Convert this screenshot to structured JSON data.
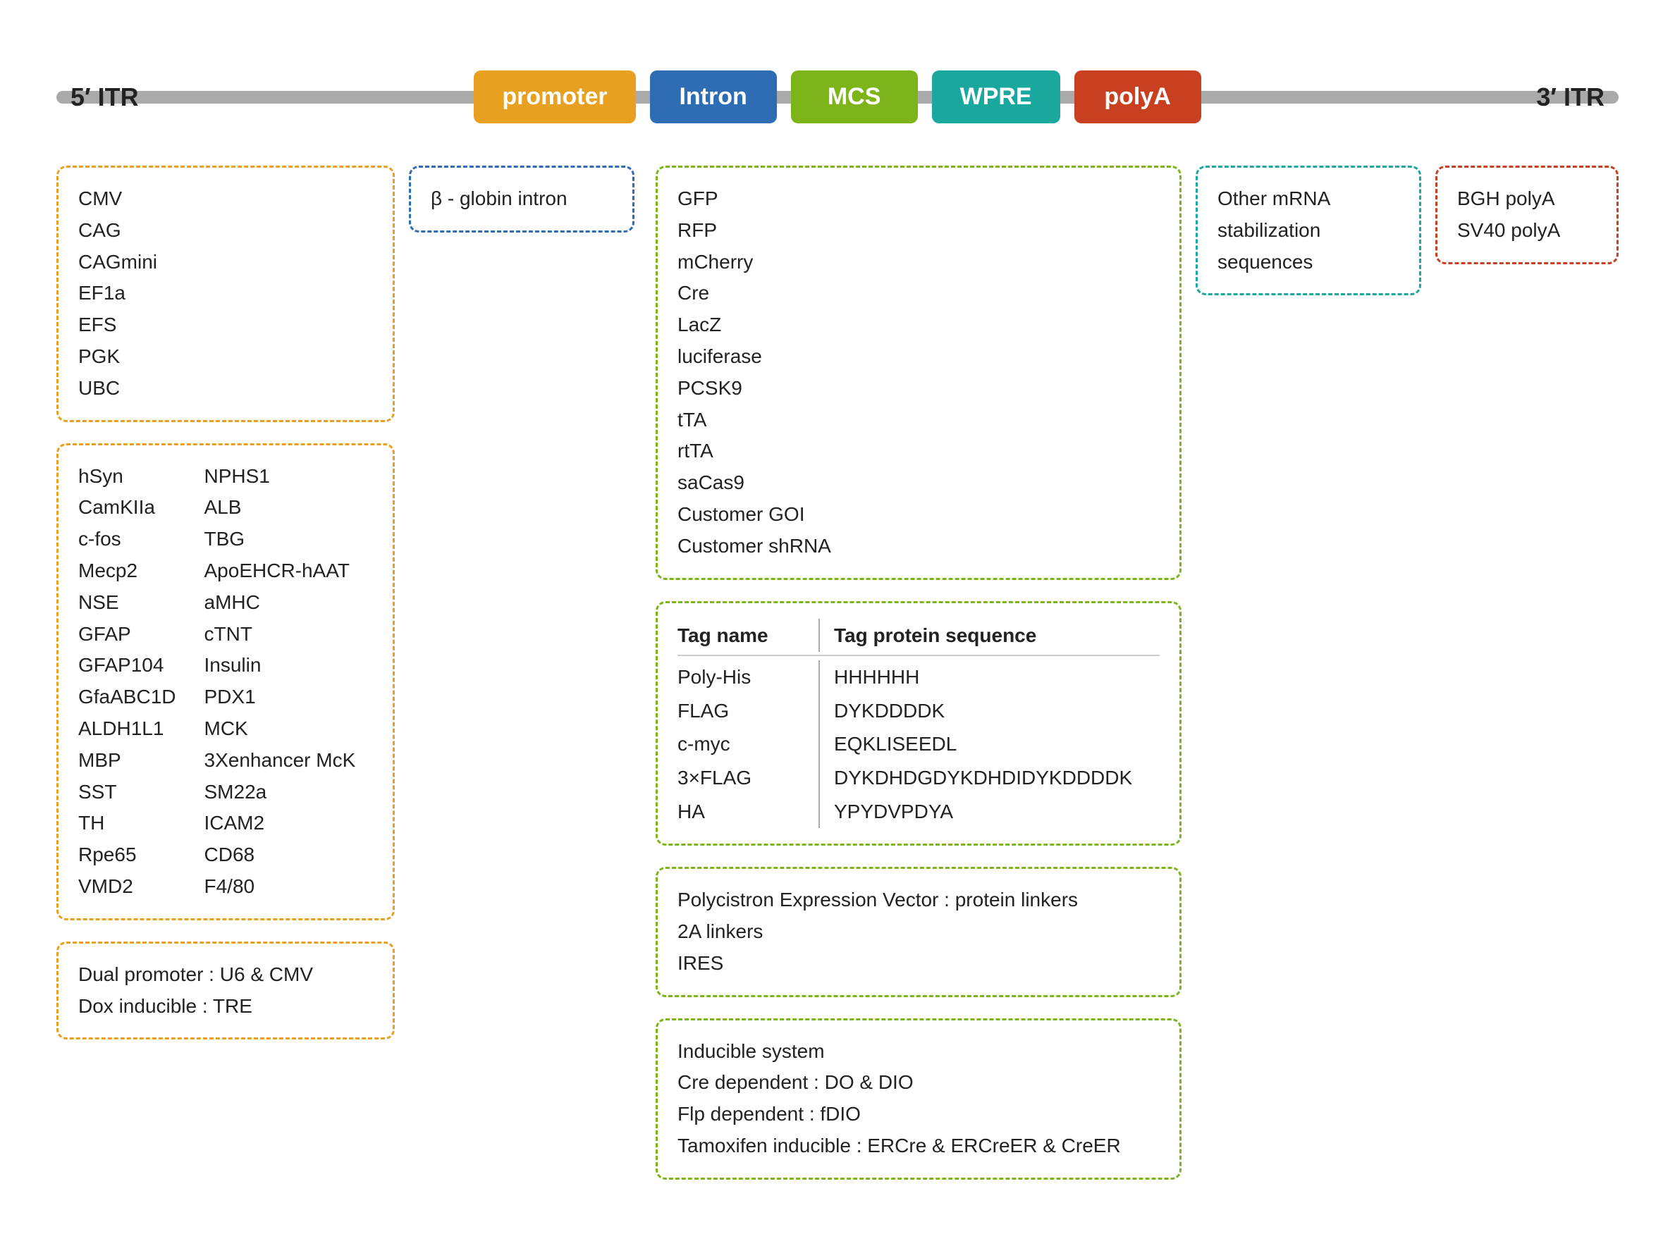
{
  "itr5": "5′ ITR",
  "itr3": "3′ ITR",
  "components": [
    {
      "label": "promoter",
      "class": "box-promoter"
    },
    {
      "label": "Intron",
      "class": "box-intron"
    },
    {
      "label": "MCS",
      "class": "box-mcs"
    },
    {
      "label": "WPRE",
      "class": "box-wpre"
    },
    {
      "label": "polyA",
      "class": "box-polya"
    }
  ],
  "promoter_box1": {
    "items": [
      "CMV",
      "CAG",
      "CAGmini",
      "EF1a",
      "EFS",
      "PGK",
      "UBC"
    ]
  },
  "promoter_box2": {
    "col1": [
      "hSyn",
      "CamKIIa",
      "c-fos",
      "Mecp2",
      "NSE",
      "GFAP",
      "GFAP104",
      "GfaABC1D",
      "ALDH1L1",
      "MBP",
      "SST",
      "TH",
      "Rpe65",
      "VMD2"
    ],
    "col2": [
      "NPHS1",
      "ALB",
      "TBG",
      "ApoEHCR-hAAT",
      "aMHC",
      "cTNT",
      "Insulin",
      "PDX1",
      "MCK",
      "3Xenhancer McK",
      "SM22a",
      "ICAM2",
      "CD68",
      "F4/80"
    ]
  },
  "promoter_box3": {
    "items": [
      "Dual promoter : U6 & CMV",
      "Dox inducible : TRE"
    ]
  },
  "intron_box1": {
    "text": "β - globin intron"
  },
  "mcs_box1": {
    "items": [
      "GFP",
      "RFP",
      "mCherry",
      "Cre",
      "LacZ",
      "luciferase",
      "PCSK9",
      "tTA",
      "rtTA",
      "saCas9",
      "Customer GOI",
      "Customer shRNA"
    ]
  },
  "mcs_tag_table": {
    "header_left": "Tag name",
    "header_right": "Tag protein sequence",
    "rows": [
      {
        "name": "Poly-His",
        "seq": "HHHHHH"
      },
      {
        "name": "FLAG",
        "seq": "DYKDDDDK"
      },
      {
        "name": "c-myc",
        "seq": "EQKLISEEDL"
      },
      {
        "name": "3×FLAG",
        "seq": "DYKDHDGDYKDHDIDYKDDDDK"
      },
      {
        "name": "HA",
        "seq": "YPYDVPDYA"
      }
    ]
  },
  "mcs_box3": {
    "items": [
      "Polycistron Expression Vector : protein linkers",
      "2A linkers",
      "IRES"
    ]
  },
  "mcs_box4": {
    "items": [
      "Inducible system",
      "Cre dependent : DO & DIO",
      "Flp dependent : fDIO",
      "Tamoxifen inducible : ERCre & ERCreER & CreER"
    ]
  },
  "wpre_box1": {
    "items": [
      "Other mRNA",
      "stabilization",
      "sequences"
    ]
  },
  "polya_box1": {
    "items": [
      "BGH  polyA",
      "SV40  polyA"
    ]
  }
}
